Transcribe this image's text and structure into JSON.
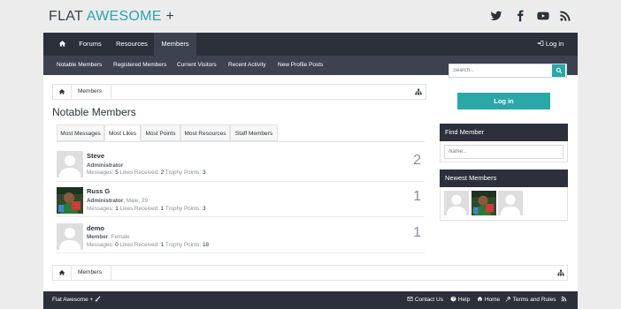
{
  "header": {
    "logo_text": "FLAT ",
    "logo_accent": "AWESOME",
    "logo_suffix": " +",
    "social_icons": [
      "twitter-icon",
      "facebook-icon",
      "youtube-icon",
      "rss-icon"
    ]
  },
  "nav": {
    "items": [
      {
        "label": "",
        "icon": "home-icon"
      },
      {
        "label": "Forums"
      },
      {
        "label": "Resources"
      },
      {
        "label": "Members",
        "active": true
      }
    ],
    "login_label": "Log in"
  },
  "subnav": {
    "items": [
      "Notable Members",
      "Registered Members",
      "Current Visitors",
      "Recent Activity",
      "New Profile Posts"
    ]
  },
  "breadcrumb": {
    "label": "Members"
  },
  "page_title": "Notable Members",
  "tabs": [
    "Most Messages",
    "Most Likes",
    "Most Points",
    "Most Resources",
    "Staff Members"
  ],
  "active_tab": "Most Likes",
  "members": [
    {
      "name": "Steve",
      "title": "Administrator",
      "extra": "",
      "messages_label": "Messages:",
      "messages": "5",
      "likes_label": "Likes Received:",
      "likes": "2",
      "points_label": "Trophy Points:",
      "points": "3",
      "rank": "2"
    },
    {
      "name": "Russ G",
      "title": "Administrator",
      "extra": ", Male, 29",
      "messages_label": "Messages:",
      "messages": "1",
      "likes_label": "Likes Received:",
      "likes": "1",
      "points_label": "Trophy Points:",
      "points": "3",
      "rank": "1"
    },
    {
      "name": "demo",
      "title": "Member",
      "extra": ", Female",
      "messages_label": "Messages:",
      "messages": "0",
      "likes_label": "Likes Received:",
      "likes": "1",
      "points_label": "Trophy Points:",
      "points": "18",
      "rank": "1"
    }
  ],
  "sidebar": {
    "search_placeholder": "Search...",
    "login_button": "Log in",
    "find_member_title": "Find Member",
    "name_placeholder": "Name...",
    "newest_members_title": "Newest Members"
  },
  "footer": {
    "brand": "Flat Awesome +",
    "links": [
      "Contact Us",
      "Help",
      "Home",
      "Terms and Rules"
    ]
  },
  "colors": {
    "accent": "#2aa7a7",
    "dark": "#2b303b",
    "subnav": "#3c4250"
  }
}
